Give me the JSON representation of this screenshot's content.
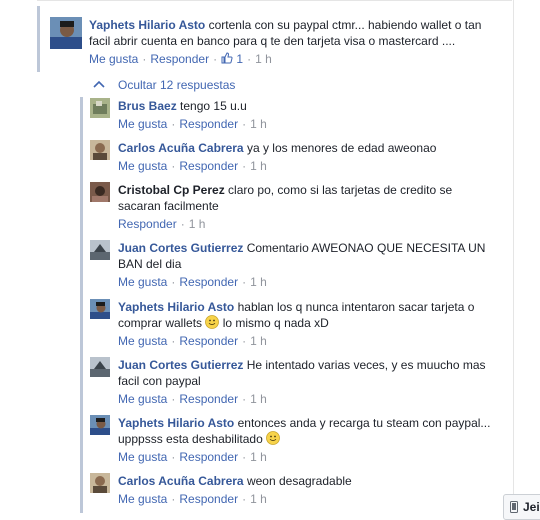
{
  "actions": {
    "like": "Me gusta",
    "reply": "Responder"
  },
  "main_comment": {
    "author": "Yaphets Hilario Asto",
    "text": "cortenla con su paypal ctmr... habiendo wallet o tan facil abrir cuenta en banco para q te den tarjeta visa o mastercard ....",
    "likes": "1",
    "time": "1 h"
  },
  "replies_toggle": "Ocultar 12 respuestas",
  "replies": [
    {
      "author": "Brus Baez",
      "text": "tengo 15 u.u",
      "time": "1 h"
    },
    {
      "author": "Carlos Acuña Cabrera",
      "text": "ya y los menores de edad aweonao",
      "time": "1 h"
    },
    {
      "author": "Cristobal Cp Perez",
      "text": "claro po, como si las tarjetas de credito se sacaran facilmente",
      "time": "1 h"
    },
    {
      "author": "Juan Cortes Gutierrez",
      "text": "Comentario AWEONAO QUE NECESITA UN BAN del dia",
      "time": "1 h"
    },
    {
      "author": "Yaphets Hilario Asto",
      "text": "hablan los q nunca intentaron sacar tarjeta o comprar wallets",
      "text2": "lo mismo q nada xD",
      "time": "1 h"
    },
    {
      "author": "Juan Cortes Gutierrez",
      "text": "He intentado varias veces, y es muucho mas facil con paypal",
      "time": "1 h"
    },
    {
      "author": "Yaphets Hilario Asto",
      "text": "entonces anda y recarga tu steam con paypal... upppsss esta deshabilitado",
      "time": "1 h"
    },
    {
      "author": "Carlos Acuña Cabrera",
      "text": "weon desagradable",
      "time": "1 h"
    }
  ],
  "chat_label": "Jei",
  "colors": {
    "author": "#365899",
    "link": "#4267b2",
    "meta": "#90949c",
    "thread_bar": "#bdc7d8"
  }
}
